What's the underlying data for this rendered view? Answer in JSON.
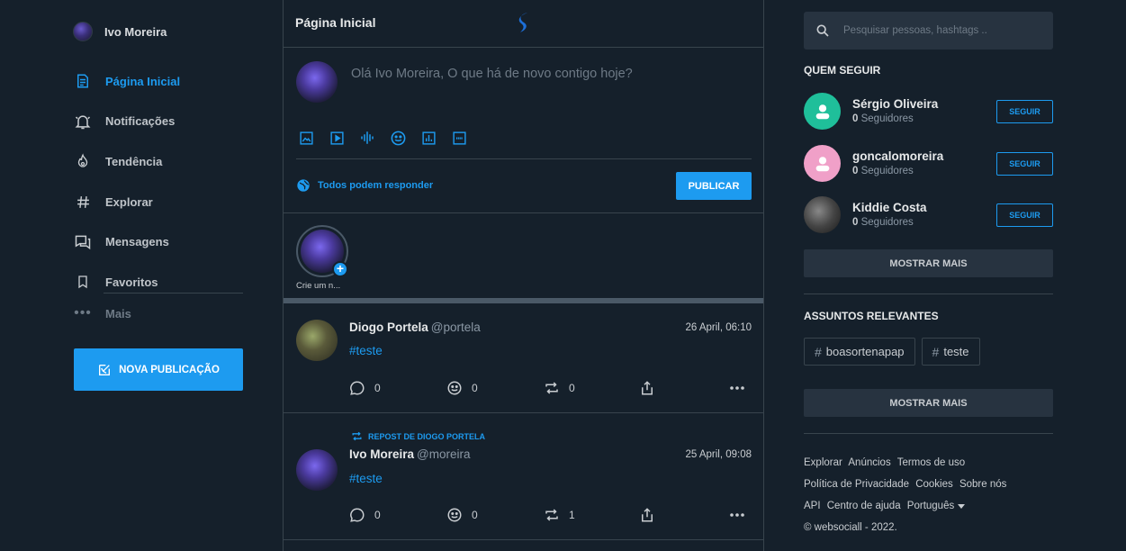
{
  "user": {
    "name": "Ivo Moreira"
  },
  "nav": [
    {
      "label": "Página Inicial",
      "icon": "document-icon",
      "active": true
    },
    {
      "label": "Notificações",
      "icon": "bell-icon"
    },
    {
      "label": "Tendência",
      "icon": "flame-icon"
    },
    {
      "label": "Explorar",
      "icon": "hash-icon"
    },
    {
      "label": "Mensagens",
      "icon": "chat-icon"
    },
    {
      "label": "Favoritos",
      "icon": "bookmark-icon"
    }
  ],
  "nav_more": {
    "glyph": "•••",
    "label": "Mais"
  },
  "new_post_button": "NOVA PUBLICAÇÃO",
  "header": {
    "title": "Página Inicial"
  },
  "composer": {
    "placeholder": "Olá Ivo Moreira, O que há de novo contigo hoje?",
    "reply_setting": "Todos podem responder",
    "publish": "PUBLICAR"
  },
  "stories": {
    "plus": "+",
    "caption": "Crie um n..."
  },
  "posts": [
    {
      "name": "Diogo Portela",
      "handle": "@portela",
      "time": "26 April, 06:10",
      "text": "#teste",
      "comments": "0",
      "reactions": "0",
      "reposts": "0"
    },
    {
      "repost_label": "REPOST DE DIOGO PORTELA",
      "name": "Ivo Moreira",
      "handle": "@moreira",
      "time": "25 April, 09:08",
      "text": "#teste",
      "comments": "0",
      "reactions": "0",
      "reposts": "1"
    }
  ],
  "search": {
    "placeholder": "Pesquisar pessoas, hashtags .."
  },
  "who_to_follow": {
    "title": "QUEM SEGUIR",
    "users": [
      {
        "name": "Sérgio Oliveira",
        "count": "0",
        "suffix": "Seguidores",
        "button": "SEGUIR",
        "color": "#1fbf9a"
      },
      {
        "name": "goncalomoreira",
        "count": "0",
        "suffix": "Seguidores",
        "button": "SEGUIR",
        "color": "#f0a0c8"
      },
      {
        "name": "Kiddie Costa",
        "count": "0",
        "suffix": "Seguidores",
        "button": "SEGUIR",
        "color": "#555555"
      }
    ],
    "show_more": "MOSTRAR MAIS"
  },
  "topics": {
    "title": "ASSUNTOS RELEVANTES",
    "hash": "#",
    "items": [
      "boasortenapap",
      "teste"
    ],
    "show_more": "MOSTRAR MAIS"
  },
  "footer": {
    "links": [
      "Explorar",
      "Anúncios",
      "Termos de uso",
      "Política de Privacidade",
      "Cookies",
      "Sobre nós",
      "API",
      "Centro de ajuda"
    ],
    "language": "Português",
    "copyright": "© websociall - 2022."
  }
}
